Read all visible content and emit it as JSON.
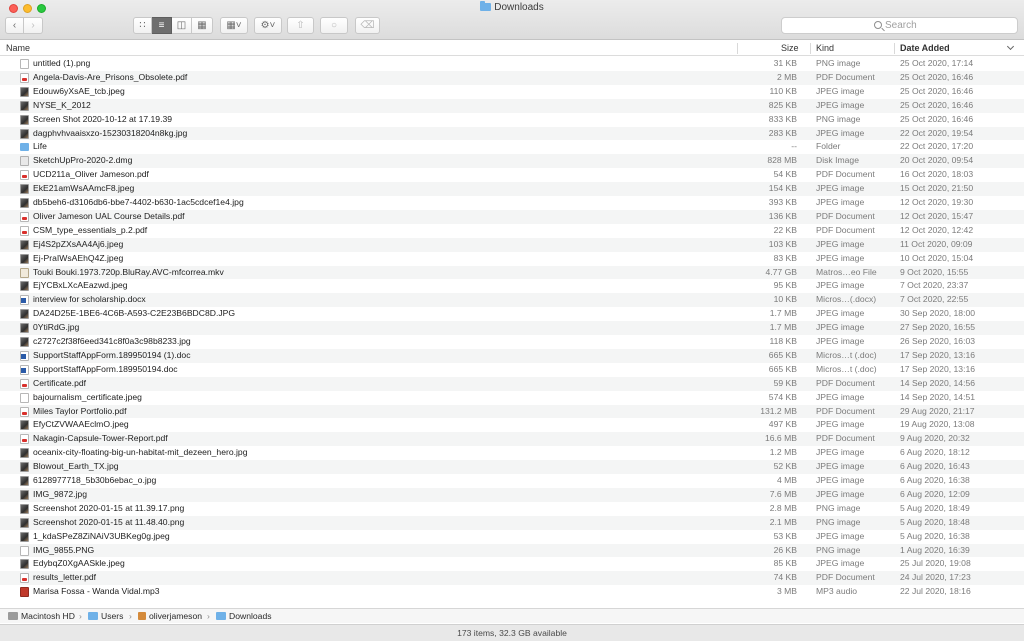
{
  "window": {
    "title": "Downloads"
  },
  "search": {
    "placeholder": "Search"
  },
  "columns": {
    "name": "Name",
    "size": "Size",
    "kind": "Kind",
    "date_added": "Date Added"
  },
  "files": [
    {
      "name": "untitled (1).png",
      "size": "31 KB",
      "kind": "PNG image",
      "date": "25 Oct 2020, 17:14",
      "icon": "png"
    },
    {
      "name": "Angela-Davis-Are_Prisons_Obsolete.pdf",
      "size": "2 MB",
      "kind": "PDF Document",
      "date": "25 Oct 2020, 16:46",
      "icon": "pdf"
    },
    {
      "name": "Edouw6yXsAE_tcb.jpeg",
      "size": "110 KB",
      "kind": "JPEG image",
      "date": "25 Oct 2020, 16:46",
      "icon": "jpeg"
    },
    {
      "name": "NYSE_K_2012",
      "size": "825 KB",
      "kind": "JPEG image",
      "date": "25 Oct 2020, 16:46",
      "icon": "jpeg"
    },
    {
      "name": "Screen Shot 2020-10-12 at 17.19.39",
      "size": "833 KB",
      "kind": "PNG image",
      "date": "25 Oct 2020, 16:46",
      "icon": "jpeg"
    },
    {
      "name": "dagphvhvaaisxzo-15230318204n8kg.jpg",
      "size": "283 KB",
      "kind": "JPEG image",
      "date": "22 Oct 2020, 19:54",
      "icon": "jpeg"
    },
    {
      "name": "Life",
      "size": "--",
      "kind": "Folder",
      "date": "22 Oct 2020, 17:20",
      "icon": "folder"
    },
    {
      "name": "SketchUpPro-2020-2.dmg",
      "size": "828 MB",
      "kind": "Disk Image",
      "date": "20 Oct 2020, 09:54",
      "icon": "dmg"
    },
    {
      "name": "UCD211a_Oliver Jameson.pdf",
      "size": "54 KB",
      "kind": "PDF Document",
      "date": "16 Oct 2020, 18:03",
      "icon": "pdf"
    },
    {
      "name": "EkE21amWsAAmcF8.jpeg",
      "size": "154 KB",
      "kind": "JPEG image",
      "date": "15 Oct 2020, 21:50",
      "icon": "jpeg"
    },
    {
      "name": "db5beh6-d3106db6-bbe7-4402-b630-1ac5cdcef1e4.jpg",
      "size": "393 KB",
      "kind": "JPEG image",
      "date": "12 Oct 2020, 19:30",
      "icon": "jpeg"
    },
    {
      "name": "Oliver Jameson UAL Course Details.pdf",
      "size": "136 KB",
      "kind": "PDF Document",
      "date": "12 Oct 2020, 15:47",
      "icon": "pdf"
    },
    {
      "name": "CSM_type_essentials_p.2.pdf",
      "size": "22 KB",
      "kind": "PDF Document",
      "date": "12 Oct 2020, 12:42",
      "icon": "pdf"
    },
    {
      "name": "Ej4S2pZXsAA4Aj6.jpeg",
      "size": "103 KB",
      "kind": "JPEG image",
      "date": "11 Oct 2020, 09:09",
      "icon": "jpeg"
    },
    {
      "name": "Ej-PraIWsAEhQ4Z.jpeg",
      "size": "83 KB",
      "kind": "JPEG image",
      "date": "10 Oct 2020, 15:04",
      "icon": "jpeg"
    },
    {
      "name": "Touki Bouki.1973.720p.BluRay.AVC-mfcorrea.mkv",
      "size": "4.77 GB",
      "kind": "Matros…eo File",
      "date": "9 Oct 2020, 15:55",
      "icon": "mkv"
    },
    {
      "name": "EjYCBxLXcAEazwd.jpeg",
      "size": "95 KB",
      "kind": "JPEG image",
      "date": "7 Oct 2020, 23:37",
      "icon": "jpeg"
    },
    {
      "name": "interview for scholarship.docx",
      "size": "10 KB",
      "kind": "Micros…(.docx)",
      "date": "7 Oct 2020, 22:55",
      "icon": "doc"
    },
    {
      "name": "DA24D25E-1BE6-4C6B-A593-C2E23B6BDC8D.JPG",
      "size": "1.7 MB",
      "kind": "JPEG image",
      "date": "30 Sep 2020, 18:00",
      "icon": "jpeg"
    },
    {
      "name": "0YtiRdG.jpg",
      "size": "1.7 MB",
      "kind": "JPEG image",
      "date": "27 Sep 2020, 16:55",
      "icon": "jpeg"
    },
    {
      "name": "c2727c2f38f6eed341c8f0a3c98b8233.jpg",
      "size": "118 KB",
      "kind": "JPEG image",
      "date": "26 Sep 2020, 16:03",
      "icon": "jpeg"
    },
    {
      "name": "SupportStaffAppForm.189950194 (1).doc",
      "size": "665 KB",
      "kind": "Micros…t (.doc)",
      "date": "17 Sep 2020, 13:16",
      "icon": "doc"
    },
    {
      "name": "SupportStaffAppForm.189950194.doc",
      "size": "665 KB",
      "kind": "Micros…t (.doc)",
      "date": "17 Sep 2020, 13:16",
      "icon": "doc"
    },
    {
      "name": "Certificate.pdf",
      "size": "59 KB",
      "kind": "PDF Document",
      "date": "14 Sep 2020, 14:56",
      "icon": "pdf"
    },
    {
      "name": "bajournalism_certificate.jpeg",
      "size": "574 KB",
      "kind": "JPEG image",
      "date": "14 Sep 2020, 14:51",
      "icon": "png"
    },
    {
      "name": "Miles Taylor Portfolio.pdf",
      "size": "131.2 MB",
      "kind": "PDF Document",
      "date": "29 Aug 2020, 21:17",
      "icon": "pdf"
    },
    {
      "name": "EfyCtZVWAAEclmO.jpeg",
      "size": "497 KB",
      "kind": "JPEG image",
      "date": "19 Aug 2020, 13:08",
      "icon": "jpeg"
    },
    {
      "name": "Nakagin-Capsule-Tower-Report.pdf",
      "size": "16.6 MB",
      "kind": "PDF Document",
      "date": "9 Aug 2020, 20:32",
      "icon": "pdf"
    },
    {
      "name": "oceanix-city-floating-big-un-habitat-mit_dezeen_hero.jpg",
      "size": "1.2 MB",
      "kind": "JPEG image",
      "date": "6 Aug 2020, 18:12",
      "icon": "jpeg"
    },
    {
      "name": "Blowout_Earth_TX.jpg",
      "size": "52 KB",
      "kind": "JPEG image",
      "date": "6 Aug 2020, 16:43",
      "icon": "jpeg"
    },
    {
      "name": "6128977718_5b30b6ebac_o.jpg",
      "size": "4 MB",
      "kind": "JPEG image",
      "date": "6 Aug 2020, 16:38",
      "icon": "jpeg"
    },
    {
      "name": "IMG_9872.jpg",
      "size": "7.6 MB",
      "kind": "JPEG image",
      "date": "6 Aug 2020, 12:09",
      "icon": "jpeg"
    },
    {
      "name": "Screenshot 2020-01-15 at 11.39.17.png",
      "size": "2.8 MB",
      "kind": "PNG image",
      "date": "5 Aug 2020, 18:49",
      "icon": "jpeg"
    },
    {
      "name": "Screenshot 2020-01-15 at 11.48.40.png",
      "size": "2.1 MB",
      "kind": "PNG image",
      "date": "5 Aug 2020, 18:48",
      "icon": "jpeg"
    },
    {
      "name": "1_kdaSPeZ8ZiNAiV3UBKeg0g.jpeg",
      "size": "53 KB",
      "kind": "JPEG image",
      "date": "5 Aug 2020, 16:38",
      "icon": "jpeg"
    },
    {
      "name": "IMG_9855.PNG",
      "size": "26 KB",
      "kind": "PNG image",
      "date": "1 Aug 2020, 16:39",
      "icon": "png"
    },
    {
      "name": "EdybqZ0XgAASkle.jpeg",
      "size": "85 KB",
      "kind": "JPEG image",
      "date": "25 Jul 2020, 19:08",
      "icon": "jpeg"
    },
    {
      "name": "results_letter.pdf",
      "size": "74 KB",
      "kind": "PDF Document",
      "date": "24 Jul 2020, 17:23",
      "icon": "pdf"
    },
    {
      "name": "Marisa Fossa - Wanda Vidal.mp3",
      "size": "3 MB",
      "kind": "MP3 audio",
      "date": "22 Jul 2020, 18:16",
      "icon": "mp3"
    }
  ],
  "pathbar": {
    "items": [
      "Macintosh HD",
      "Users",
      "oliverjameson",
      "Downloads"
    ]
  },
  "status": {
    "text": "173 items, 32.3 GB available"
  }
}
